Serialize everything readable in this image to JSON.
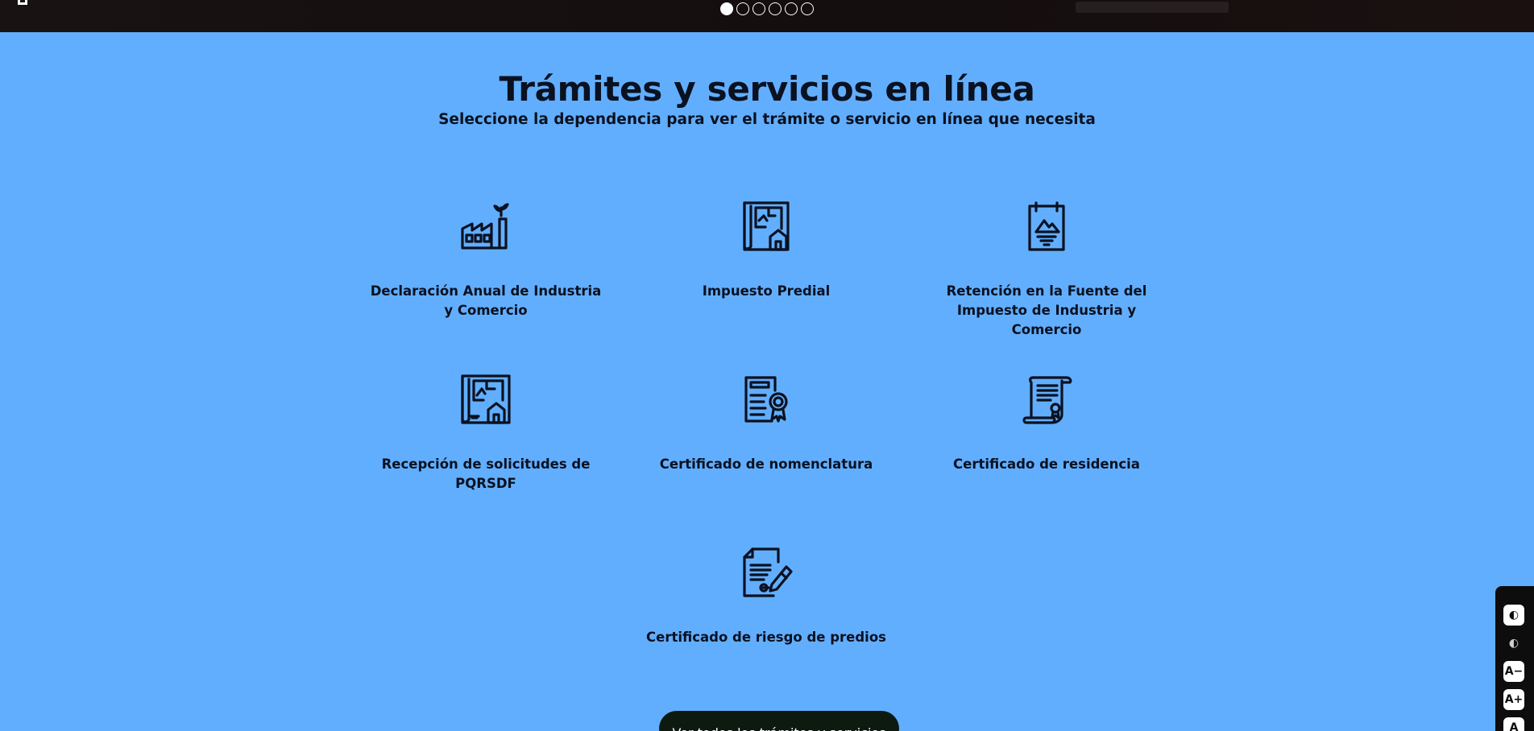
{
  "slider": {
    "logo_text": "L",
    "dots": [
      {
        "active": true
      },
      {
        "active": false
      },
      {
        "active": false
      },
      {
        "active": false
      },
      {
        "active": false
      },
      {
        "active": false
      }
    ]
  },
  "section": {
    "title": "Trámites y servicios en línea",
    "subtitle": "Seleccione la dependencia para ver el trámite o servicio en línea que necesita"
  },
  "services": [
    {
      "label": "Declaración Anual de Industria y Comercio",
      "icon": "factory-icon"
    },
    {
      "label": "Impuesto Predial",
      "icon": "house-blueprint-icon"
    },
    {
      "label": "Retención en la Fuente del Impuesto de Industria y Comercio",
      "icon": "calendar-document-icon"
    },
    {
      "label": "Recepción de solicitudes de PQRSDF",
      "icon": "blueprint-icon"
    },
    {
      "label": "Certificado de nomenclatura",
      "icon": "certificate-seal-icon"
    },
    {
      "label": "Certificado de residencia",
      "icon": "scroll-certificate-icon"
    },
    {
      "label": "Certificado de riesgo de predios",
      "icon": "document-sign-icon"
    }
  ],
  "cta": {
    "label": "Ver todos los trámites y servicios"
  },
  "accessibility": {
    "buttons": [
      {
        "icon": "contrast-icon",
        "glyph": "◐"
      },
      {
        "icon": "dark-mode-icon",
        "glyph": "◐"
      },
      {
        "icon": "decrease-font-icon",
        "glyph": "A−"
      },
      {
        "icon": "increase-font-icon",
        "glyph": "A+"
      },
      {
        "icon": "font-reset-icon",
        "glyph": "A"
      }
    ]
  },
  "colors": {
    "background": "#62aefe",
    "text": "#0a1120",
    "hero": "#181212",
    "cta": "#0c1a10"
  }
}
